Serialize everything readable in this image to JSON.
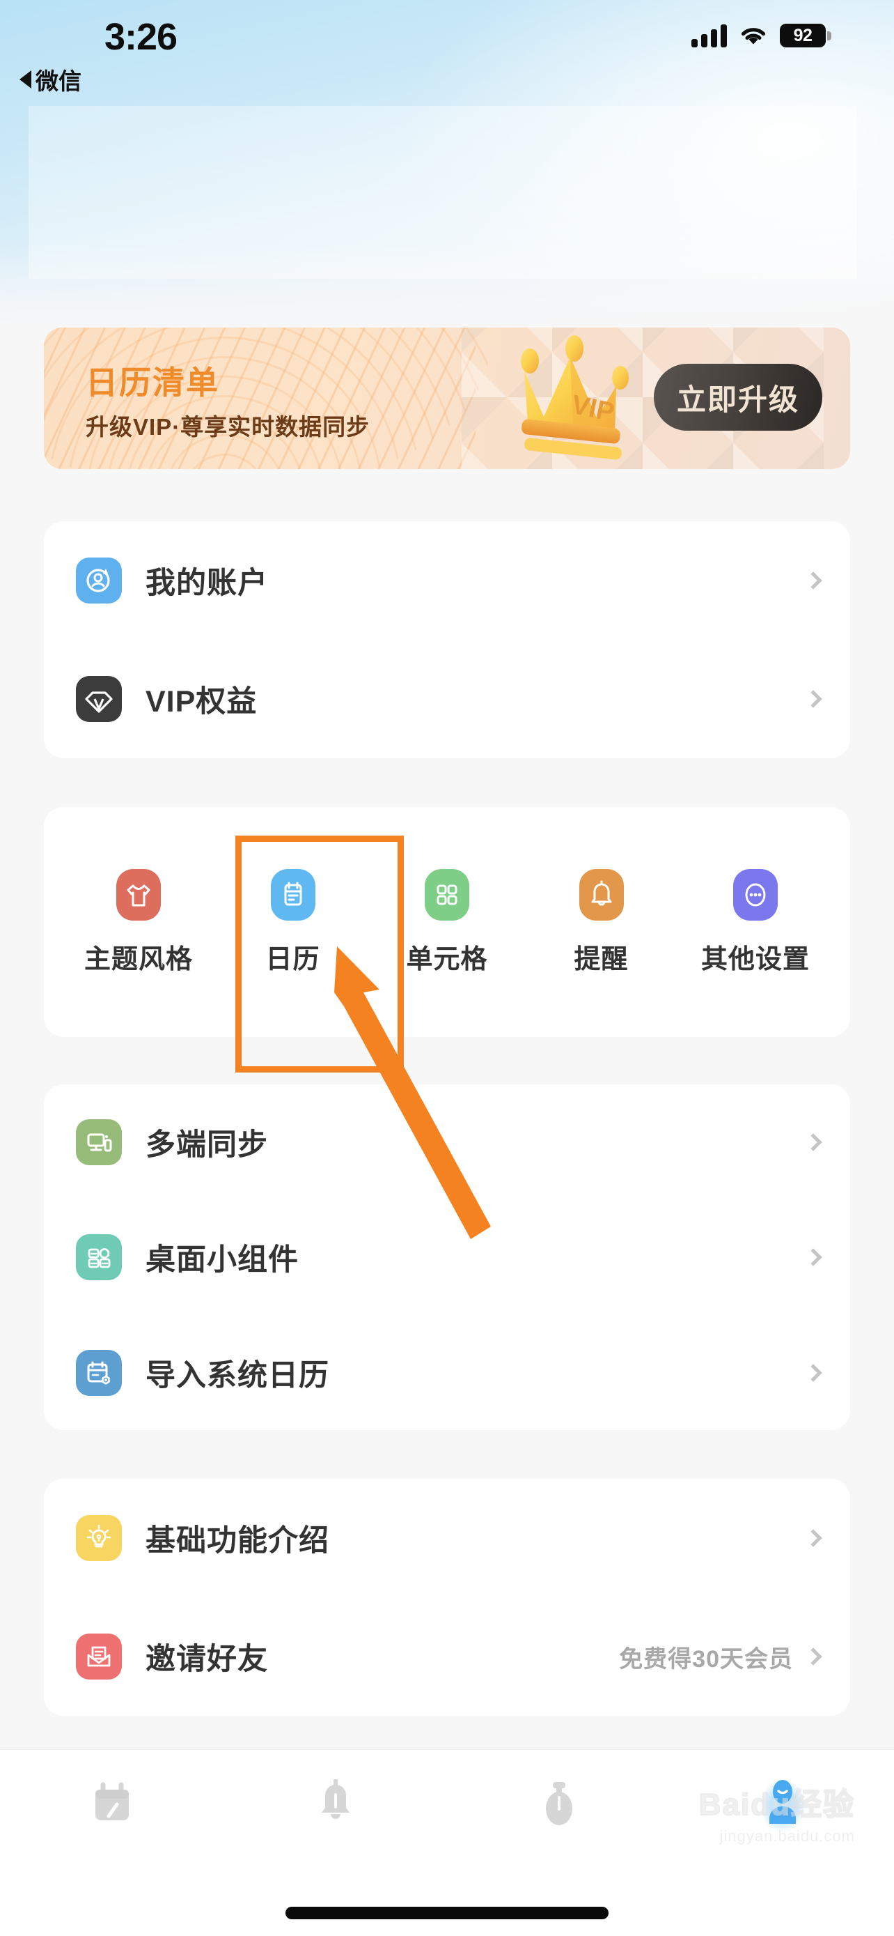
{
  "status_bar": {
    "time": "3:26",
    "battery_level": "92",
    "signal_icon": "cellular-signal-icon",
    "wifi_icon": "wifi-icon",
    "battery_icon": "battery-icon"
  },
  "back_link": {
    "label": "微信",
    "icon": "back-caret-icon"
  },
  "vip_banner": {
    "title": "日历清单",
    "subtitle": "升级VIP·尊享实时数据同步",
    "button_label": "立即升级",
    "crown_badge": "VIP",
    "crown_icon": "crown-icon",
    "title_color": "#ef8b2a",
    "subtitle_color": "#6c3b18",
    "bg_color": "#fbe0c3",
    "button_color": "#3a332f"
  },
  "account_card": {
    "rows": [
      {
        "label": "我的账户",
        "icon": "account-sync-icon",
        "icon_color": "#5fb0ef",
        "chevron": "chevron-right-icon"
      },
      {
        "label": "VIP权益",
        "icon": "diamond-icon",
        "icon_color": "#3c3c3c",
        "chevron": "chevron-right-icon"
      }
    ]
  },
  "quick_grid": {
    "items": [
      {
        "label": "主题风格",
        "icon": "shirt-icon",
        "icon_color": "#dd6e5e"
      },
      {
        "label": "日历",
        "icon": "calendar-clipboard-icon",
        "icon_color": "#5fb8f0"
      },
      {
        "label": "单元格",
        "icon": "grid-squares-icon",
        "icon_color": "#7fce88"
      },
      {
        "label": "提醒",
        "icon": "bell-icon",
        "icon_color": "#e3974a"
      },
      {
        "label": "其他设置",
        "icon": "more-dots-icon",
        "icon_color": "#7b78ee"
      }
    ]
  },
  "tools_card": {
    "rows": [
      {
        "label": "多端同步",
        "icon": "multi-device-sync-icon",
        "icon_color": "#97bb78",
        "chevron": "chevron-right-icon"
      },
      {
        "label": "桌面小组件",
        "icon": "widgets-icon",
        "icon_color": "#6fcbb4",
        "chevron": "chevron-right-icon"
      },
      {
        "label": "导入系统日历",
        "icon": "import-calendar-icon",
        "icon_color": "#5d9fd0",
        "chevron": "chevron-right-icon"
      }
    ]
  },
  "help_card": {
    "rows": [
      {
        "label": "基础功能介绍",
        "extra": "",
        "icon": "lightbulb-icon",
        "icon_color": "#f8d561",
        "chevron": "chevron-right-icon"
      },
      {
        "label": "邀请好友",
        "extra": "免费得30天会员",
        "icon": "invite-envelope-icon",
        "icon_color": "#ef7070",
        "chevron": "chevron-right-icon"
      }
    ]
  },
  "tabbar": {
    "tabs": [
      {
        "name": "calendar",
        "icon": "calendar-tab-icon",
        "active": false
      },
      {
        "name": "reminder",
        "icon": "bell-tab-icon",
        "active": false
      },
      {
        "name": "timer",
        "icon": "stopwatch-tab-icon",
        "active": false
      },
      {
        "name": "profile",
        "icon": "person-tab-icon",
        "active": true
      }
    ],
    "active_color": "#4aa8f0",
    "inactive_color": "#d4d4d4"
  },
  "annotation": {
    "highlight_target": "日历",
    "box_color": "#f58220",
    "arrow_icon": "annotation-arrow-icon"
  },
  "watermark": {
    "main": "Baidu经验",
    "sub": "jingyan.baidu.com"
  }
}
